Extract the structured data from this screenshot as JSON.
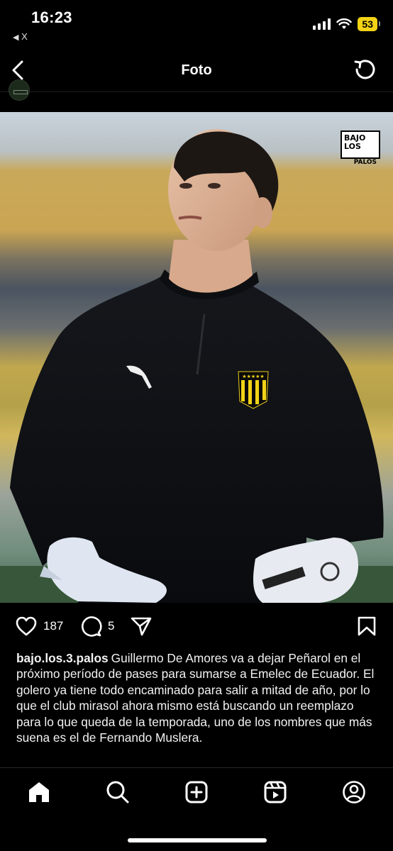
{
  "status_bar": {
    "time": "16:23",
    "back_app": "X",
    "battery": "53",
    "battery_color": "#f2d316"
  },
  "header": {
    "title": "Foto",
    "back_icon": "chevron-left-icon",
    "refresh_icon": "refresh-icon"
  },
  "photo": {
    "watermark_line1": "BAJO LOS",
    "watermark_line2": "PALOS"
  },
  "actions": {
    "likes": "187",
    "comments": "5",
    "icons": [
      "heart-icon",
      "comment-icon",
      "share-icon",
      "bookmark-icon"
    ]
  },
  "caption": {
    "username": "bajo.los.3.palos",
    "text": "Guillermo De Amores va a dejar Peñarol en el próximo período de pases para sumarse a Emelec de Ecuador. El golero ya tiene todo encaminado para salir a mitad de año, por lo que el club mirasol ahora mismo está buscando un reemplazo para lo que queda de la temporada, uno de los nombres que más suena es el de Fernando Muslera."
  },
  "bottom_nav": {
    "tabs": [
      "home-icon",
      "search-icon",
      "create-icon",
      "reels-icon",
      "profile-icon"
    ]
  }
}
